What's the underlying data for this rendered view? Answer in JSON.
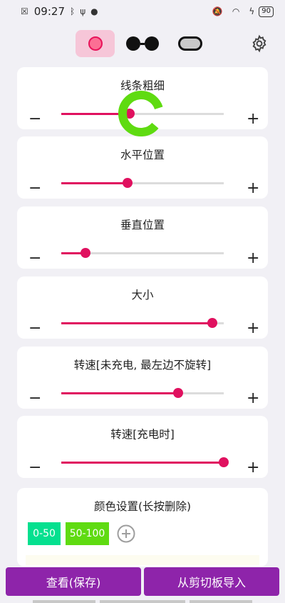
{
  "status_bar": {
    "time": "09:27",
    "battery": "90",
    "left_icons": [
      "notification-x-icon",
      "bluetooth-icon",
      "usb-icon",
      "vpn-icon"
    ],
    "right_icons": [
      "mute-icon",
      "wifi-icon",
      "charging-icon"
    ]
  },
  "toolbar": {
    "styles": [
      "ring",
      "dots",
      "pill"
    ],
    "selected_style": "ring",
    "accent_color": "#e0115f",
    "selected_bg": "#f6c6d8"
  },
  "sliders": [
    {
      "label": "线条粗细",
      "minus": "−",
      "plus": "+",
      "level": 0.42
    },
    {
      "label": "水平位置",
      "minus": "−",
      "plus": "+",
      "level": 0.41
    },
    {
      "label": "垂直位置",
      "minus": "−",
      "plus": "+",
      "level": 0.15
    },
    {
      "label": "大小",
      "minus": "−",
      "plus": "+",
      "level": 0.93
    },
    {
      "label": "转速[未充电, 最左边不旋转]",
      "minus": "−",
      "plus": "+",
      "level": 0.72
    },
    {
      "label": "转速[充电时]",
      "minus": "−",
      "plus": "+",
      "level": 1.0
    }
  ],
  "color_settings": {
    "title": "颜色设置(长按删除)",
    "ranges": [
      {
        "label": "0-50",
        "color": "#05e08f"
      },
      {
        "label": "50-100",
        "color": "#5fdb11"
      }
    ]
  },
  "preview": {
    "ring_color": "#5fdb11"
  },
  "buttons": {
    "view_save": "查看(保存)",
    "import_clipboard": "从剪切板导入"
  }
}
